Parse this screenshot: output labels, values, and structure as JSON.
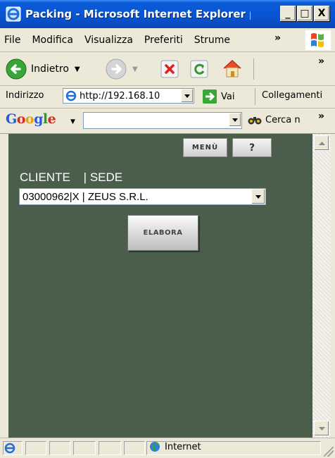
{
  "window": {
    "title": "Packing - Microsoft Internet Explorer pr...",
    "min_label": "_",
    "max_label": "□",
    "close_label": "X"
  },
  "menu": {
    "items": [
      "File",
      "Modifica",
      "Visualizza",
      "Preferiti",
      "Strume"
    ],
    "more": "»"
  },
  "toolbar": {
    "back_label": "Indietro",
    "more": "»"
  },
  "address": {
    "label": "Indirizzo",
    "url": "http://192.168.10",
    "go_label": "Vai",
    "links_label": "Collegamenti"
  },
  "google": {
    "logo": "Google",
    "search_value": "",
    "cerca_label": "Cerca n",
    "more": "»"
  },
  "page": {
    "menu_button": "MENÙ",
    "help_button": "?",
    "cliente_label": "CLIENTE    | SEDE",
    "cliente_selected": "03000962|X | ZEUS S.R.L.",
    "elabora_button": "ELABORA"
  },
  "status": {
    "zone_label": "Internet"
  },
  "colors": {
    "content_bg": "#4a5e4b",
    "titlebar": "#0854d1"
  }
}
